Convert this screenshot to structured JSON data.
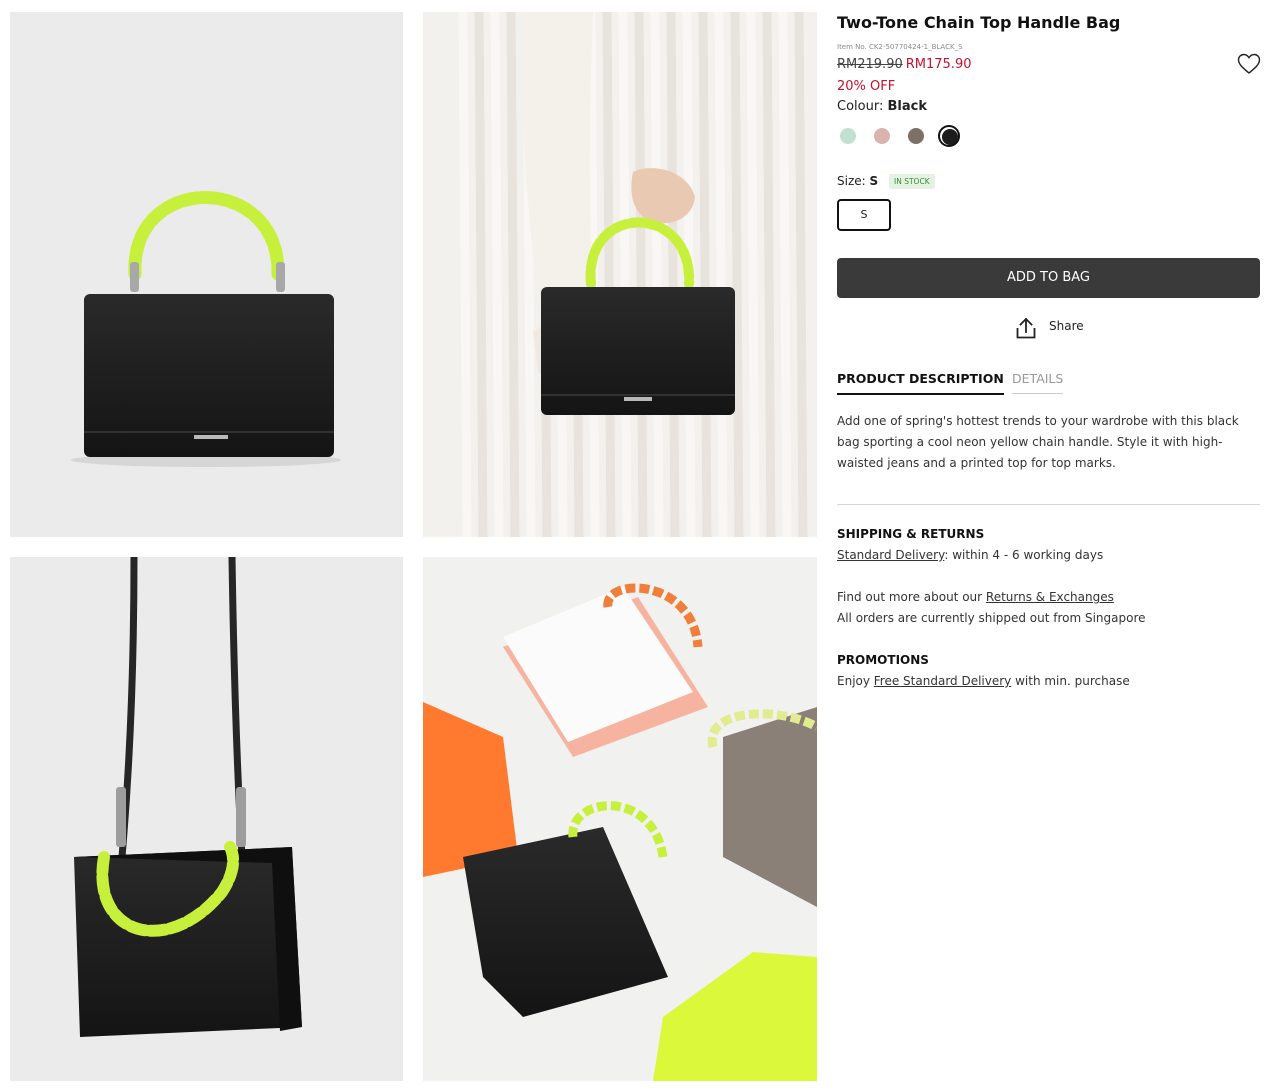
{
  "product": {
    "title": "Two-Tone Chain Top Handle Bag",
    "item_no": "Item No. CK2-50770424-1_BLACK_S",
    "price_original": "RM219.90",
    "price_sale": "RM175.90",
    "discount": "20% OFF"
  },
  "colour": {
    "label": "Colour:",
    "selected": "Black",
    "swatches": [
      {
        "name": "mint",
        "hex": "#bfe0d2"
      },
      {
        "name": "pink",
        "hex": "#d9b3ae"
      },
      {
        "name": "taupe",
        "hex": "#7d7167"
      },
      {
        "name": "black",
        "hex": "#1c1c1c"
      }
    ]
  },
  "size": {
    "label": "Size:",
    "selected": "S",
    "stock": "IN STOCK",
    "option": "S"
  },
  "actions": {
    "add_to_bag": "ADD TO BAG",
    "share": "Share",
    "wishlist_icon": "heart-icon",
    "share_icon": "share-upload-icon"
  },
  "tabs": {
    "description": "PRODUCT DESCRIPTION",
    "details": "DETAILS"
  },
  "description": "Add one of spring's hottest trends to your wardrobe with this black bag sporting a cool neon yellow chain handle. Style it with high-waisted jeans and a printed top for top marks.",
  "shipping": {
    "heading": "SHIPPING & RETURNS",
    "delivery_link": "Standard Delivery",
    "delivery_text": ": within 4 - 6 working days",
    "returns_prefix": "Find out more about our ",
    "returns_link": "Returns & Exchanges",
    "shipped_from": "All orders are currently shipped out from Singapore"
  },
  "promotions": {
    "heading": "PROMOTIONS",
    "prefix": "Enjoy ",
    "link": "Free Standard Delivery",
    "suffix": " with min. purchase"
  },
  "colors": {
    "sale": "#c8102e",
    "button": "#3a3a3a",
    "neon": "#c6f03c"
  }
}
